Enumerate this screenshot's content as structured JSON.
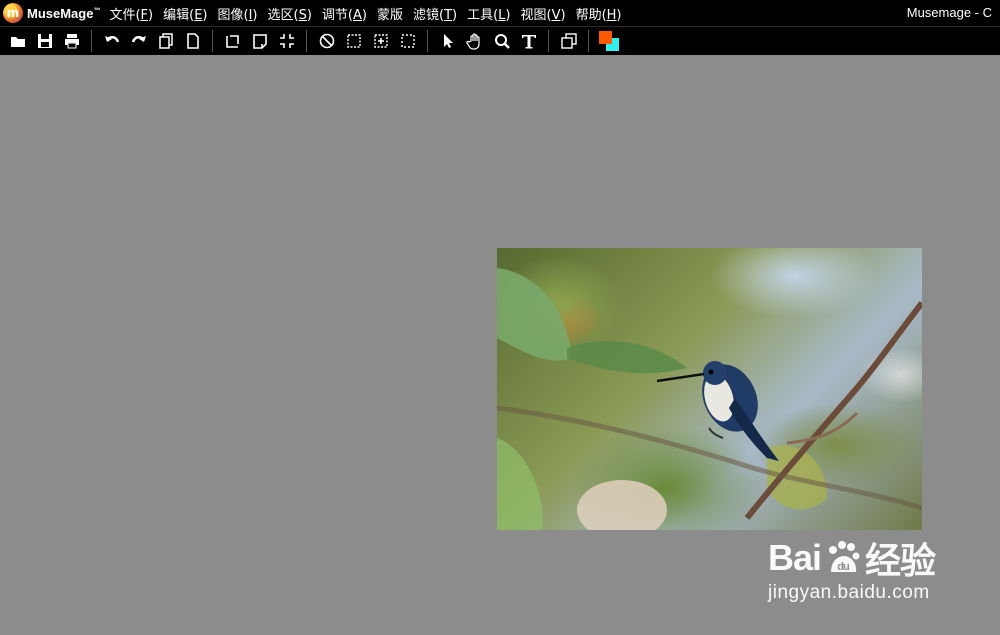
{
  "app": {
    "name": "MuseMage",
    "trademark": "™",
    "logo_letter": "m",
    "window_title": "Musemage - C"
  },
  "menu": [
    {
      "label": "文件(",
      "key": "F",
      "end": ")"
    },
    {
      "label": "编辑(",
      "key": "E",
      "end": ")"
    },
    {
      "label": "图像(",
      "key": "I",
      "end": ")"
    },
    {
      "label": "选区(",
      "key": "S",
      "end": ")"
    },
    {
      "label": "调节(",
      "key": "A",
      "end": ")"
    },
    {
      "label": "蒙版",
      "key": "",
      "end": ""
    },
    {
      "label": "滤镜(",
      "key": "T",
      "end": ")"
    },
    {
      "label": "工具(",
      "key": "L",
      "end": ")"
    },
    {
      "label": "视图(",
      "key": "V",
      "end": ")"
    },
    {
      "label": "帮助(",
      "key": "H",
      "end": ")"
    }
  ],
  "toolbar": {
    "icons": [
      "open-folder-icon",
      "save-icon",
      "print-icon",
      "sep",
      "undo-icon",
      "redo-icon",
      "copy-icon",
      "new-document-icon",
      "sep",
      "rotate-icon",
      "flip-icon",
      "crop-fit-icon",
      "sep",
      "deselect-icon",
      "select-all-icon",
      "select-center-icon",
      "marquee-icon",
      "sep",
      "pointer-icon",
      "hand-icon",
      "zoom-icon",
      "text-tool-icon",
      "sep",
      "layers-icon",
      "sep",
      "color-swatch-icon"
    ],
    "colors": {
      "foreground": "#ff5a00",
      "background": "#30f0f0"
    }
  },
  "watermark": {
    "brand_left": "Bai",
    "brand_right": "经验",
    "url": "jingyan.baidu.com"
  }
}
